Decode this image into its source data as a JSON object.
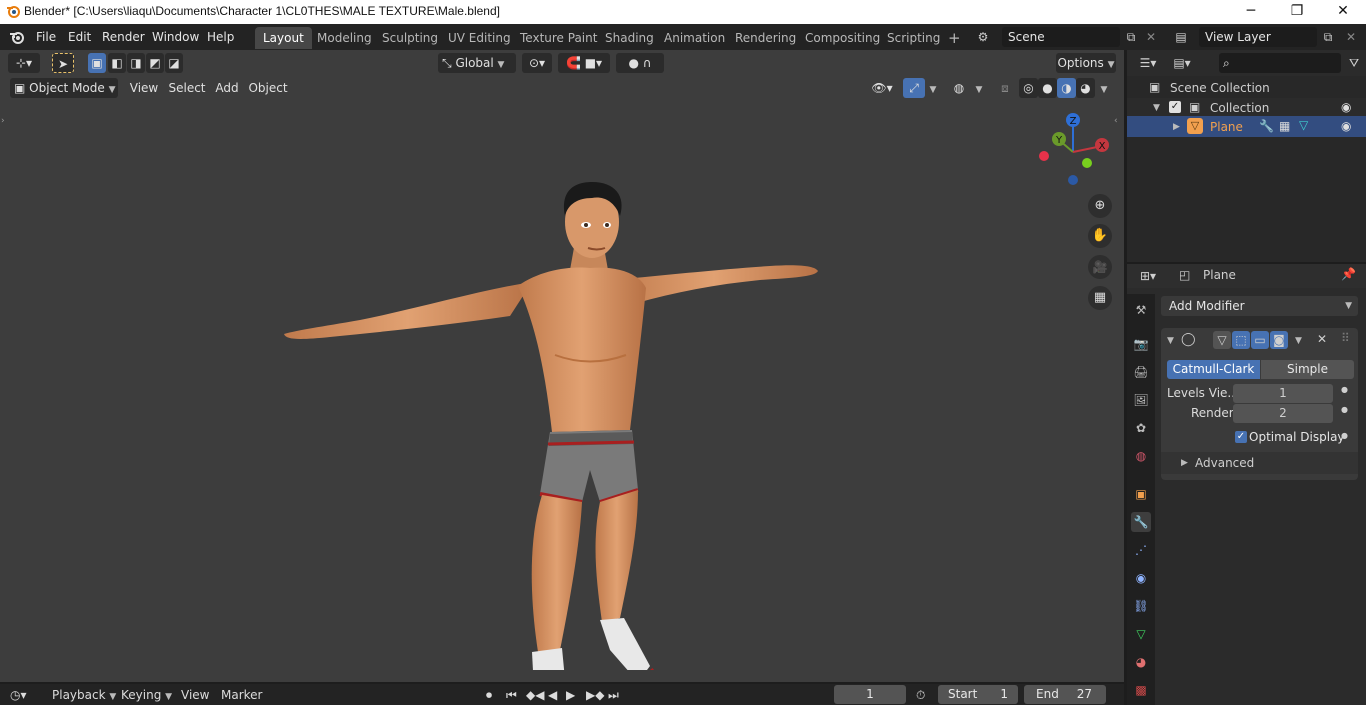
{
  "window": {
    "title": "Blender* [C:\\Users\\liaqu\\Documents\\Character 1\\CL0THES\\MALE TEXTURE\\Male.blend]",
    "minimize": "─",
    "maximize": "❐",
    "close": "✕"
  },
  "menu": {
    "file": "File",
    "edit": "Edit",
    "render": "Render",
    "window": "Window",
    "help": "Help"
  },
  "workspaces": [
    "Layout",
    "Modeling",
    "Sculpting",
    "UV Editing",
    "Texture Paint",
    "Shading",
    "Animation",
    "Rendering",
    "Compositing",
    "Scripting"
  ],
  "workspace_add": "+",
  "scene": {
    "name": "Scene"
  },
  "view_layer": {
    "name": "View Layer"
  },
  "viewport": {
    "transform_orientation": "Global",
    "options": "Options",
    "mode": "Object Mode",
    "menus": {
      "view": "View",
      "select": "Select",
      "add": "Add",
      "object": "Object"
    },
    "gizmo": {
      "z": "Z",
      "y": "Y",
      "x": "X"
    }
  },
  "outliner": {
    "scene_collection": "Scene Collection",
    "collection": "Collection",
    "object": "Plane",
    "search_placeholder": ""
  },
  "properties": {
    "object_name": "Plane",
    "add_modifier": "Add Modifier",
    "subdivision": {
      "catmull": "Catmull-Clark",
      "simple": "Simple",
      "levels_label": "Levels Vie...",
      "levels_value": "1",
      "render_label": "Render",
      "render_value": "2",
      "optimal_display": "Optimal Display",
      "advanced": "Advanced"
    }
  },
  "timeline": {
    "playback": "Playback",
    "keying": "Keying",
    "view": "View",
    "marker": "Marker",
    "current_frame": "1",
    "start_label": "Start",
    "start_value": "1",
    "end_label": "End",
    "end_value": "27"
  },
  "colors": {
    "accent": "#4772b3",
    "viewport_bg": "#3d3d3d",
    "skin": "#d9905f",
    "shorts": "#7a7a7a",
    "trim": "#a81f1f"
  }
}
